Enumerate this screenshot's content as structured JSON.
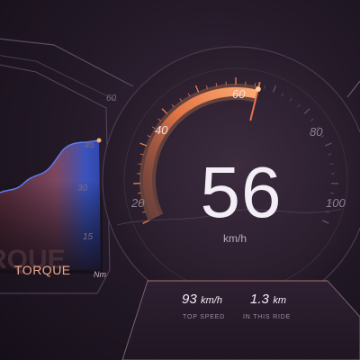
{
  "speedometer": {
    "speed": "56",
    "unit": "km/h",
    "current_speed_value": 56,
    "scale_max": 100,
    "tick_labels": [
      "20",
      "40",
      "60",
      "80",
      "100"
    ]
  },
  "torque_panel": {
    "label": "TORQUE",
    "ghost_label": "RQUE",
    "unit": "Nm",
    "scale_labels": [
      "60",
      "45",
      "30",
      "15"
    ]
  },
  "stats": {
    "top_speed": {
      "value": "93",
      "unit": "km/h",
      "caption": "TOP SPEED"
    },
    "ride_distance": {
      "value": "1.3",
      "unit": "km",
      "caption": "IN THIS RIDE"
    }
  },
  "colors": {
    "accent_orange": "#f0824a",
    "needle": "#e8734a",
    "graph_blue": "#3d5fd6",
    "graph_pink": "#c0647a"
  }
}
